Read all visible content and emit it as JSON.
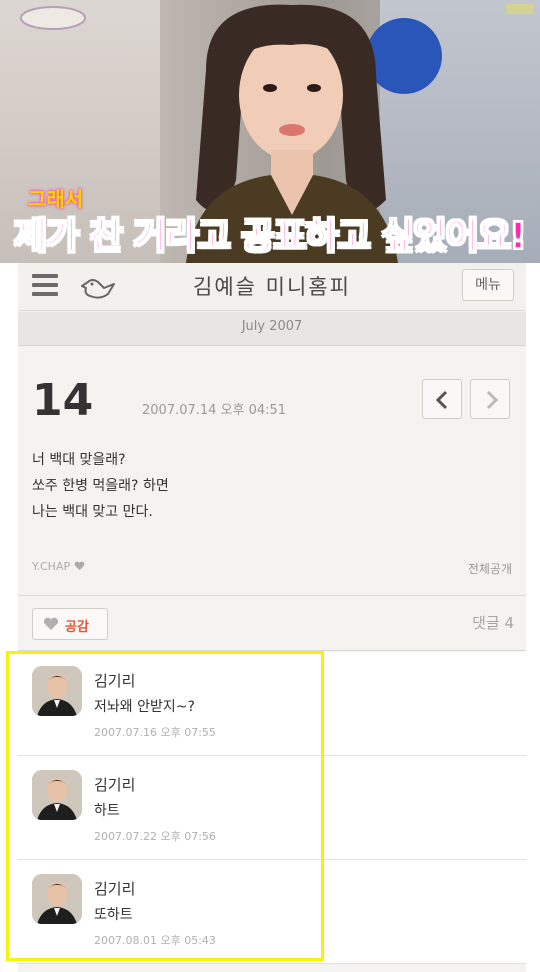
{
  "tv": {
    "caption_small": "그래서",
    "caption": "제가 찬 거라고 공표하고 싶었어요!"
  },
  "header": {
    "title": "김예슬 미니홈피",
    "menu_label": "메뉴"
  },
  "month_label": "July 2007",
  "post": {
    "day": "14",
    "datetime": "2007.07.14 오후 04:51",
    "lines": [
      "너 백대 맞을래?",
      "쏘주 한병 먹을래? 하면",
      "나는 백대 맞고 만다."
    ],
    "author_tag": "Y.CHAP",
    "visibility": "전체공개"
  },
  "actions": {
    "like_label": "공감",
    "reply_count": "댓글 4"
  },
  "comments": [
    {
      "name": "김기리",
      "text": "저놔왜 안받지~?",
      "date": "2007.07.16 오후 07:55"
    },
    {
      "name": "김기리",
      "text": "하트",
      "date": "2007.07.22 오후 07:56"
    },
    {
      "name": "김기리",
      "text": "또하트",
      "date": "2007.08.01 오후 05:43"
    }
  ],
  "colors": {
    "caption_pink": "#ff2ab0",
    "like_red": "#e0553d",
    "highlight_yellow": "#f7f20a"
  },
  "icons": {
    "menu": "hamburger-icon",
    "bird": "bird-icon",
    "prev": "chevron-left-icon",
    "next": "chevron-right-icon",
    "heart": "heart-icon"
  }
}
